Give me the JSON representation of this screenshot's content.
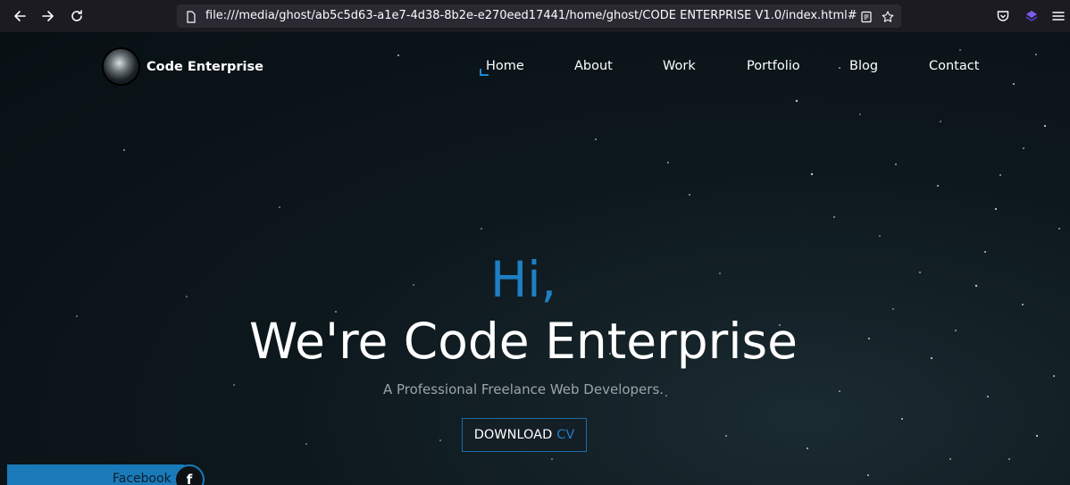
{
  "browser": {
    "url": "file:///media/ghost/ab5c5d63-a1e7-4d38-8b2e-e270eed17441/home/ghost/CODE ENTERPRISE V1.0/index.html#",
    "icons": [
      "back-icon",
      "forward-icon",
      "reload-icon",
      "page-icon",
      "reader-view-icon",
      "bookmark-star-icon",
      "pocket-icon",
      "extension-icon",
      "menu-icon"
    ]
  },
  "site": {
    "brand": "Code Enterprise",
    "nav": [
      "Home",
      "About",
      "Work",
      "Portfolio",
      "Blog",
      "Contact"
    ],
    "active_nav": "Home",
    "accent_color": "#1f7fc4"
  },
  "hero": {
    "greeting": "Hi,",
    "headline": "We're Code Enterprise",
    "tagline": "A Professional Freelance Web Developers.",
    "cta_main": "DOWNLOAD",
    "cta_accent": "CV"
  },
  "social": {
    "label": "Facebook",
    "icon_glyph": "f"
  }
}
